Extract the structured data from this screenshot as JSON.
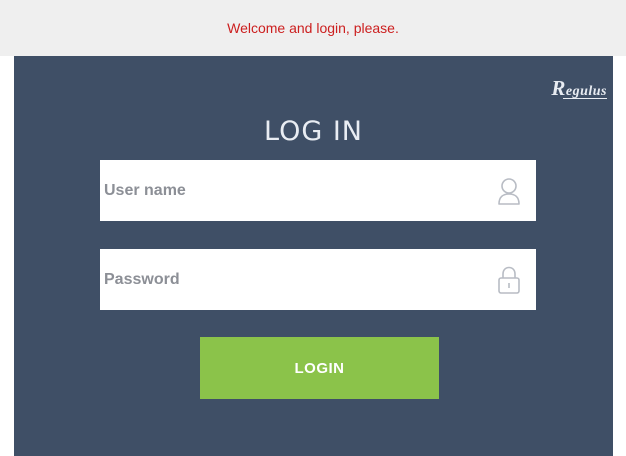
{
  "banner": {
    "message": "Welcome and login, please."
  },
  "brand": {
    "logo_initial": "R",
    "logo_rest": "egulus"
  },
  "login_form": {
    "title": "LOG IN",
    "username_placeholder": "User name",
    "username_value": "",
    "username_icon": "user-icon",
    "password_placeholder": "Password",
    "password_value": "",
    "password_icon": "lock-icon",
    "submit_label": "LOGIN"
  },
  "colors": {
    "banner_bg": "#efefef",
    "banner_text": "#cc1f1f",
    "panel_bg": "#3f4f66",
    "button_bg": "#8bc34a",
    "icon_stroke": "#b8bcc4"
  }
}
